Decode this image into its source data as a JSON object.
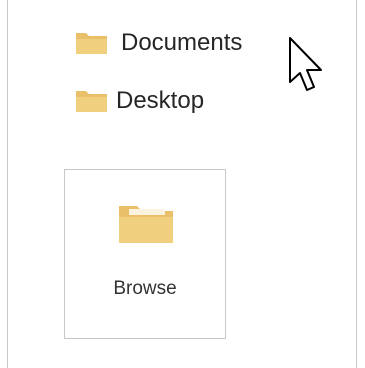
{
  "places": {
    "items": [
      {
        "label": "Documents",
        "icon": "folder-icon"
      },
      {
        "label": "Desktop",
        "icon": "folder-icon"
      }
    ]
  },
  "browse": {
    "label": "Browse",
    "icon": "open-folder-icon"
  },
  "pointer": {
    "icon": "mouse-cursor-arrow-icon"
  },
  "colors": {
    "folder_fill": "#f0cf7e",
    "folder_tab": "#e9c069",
    "border": "#c8c8c8",
    "text": "#262626"
  }
}
